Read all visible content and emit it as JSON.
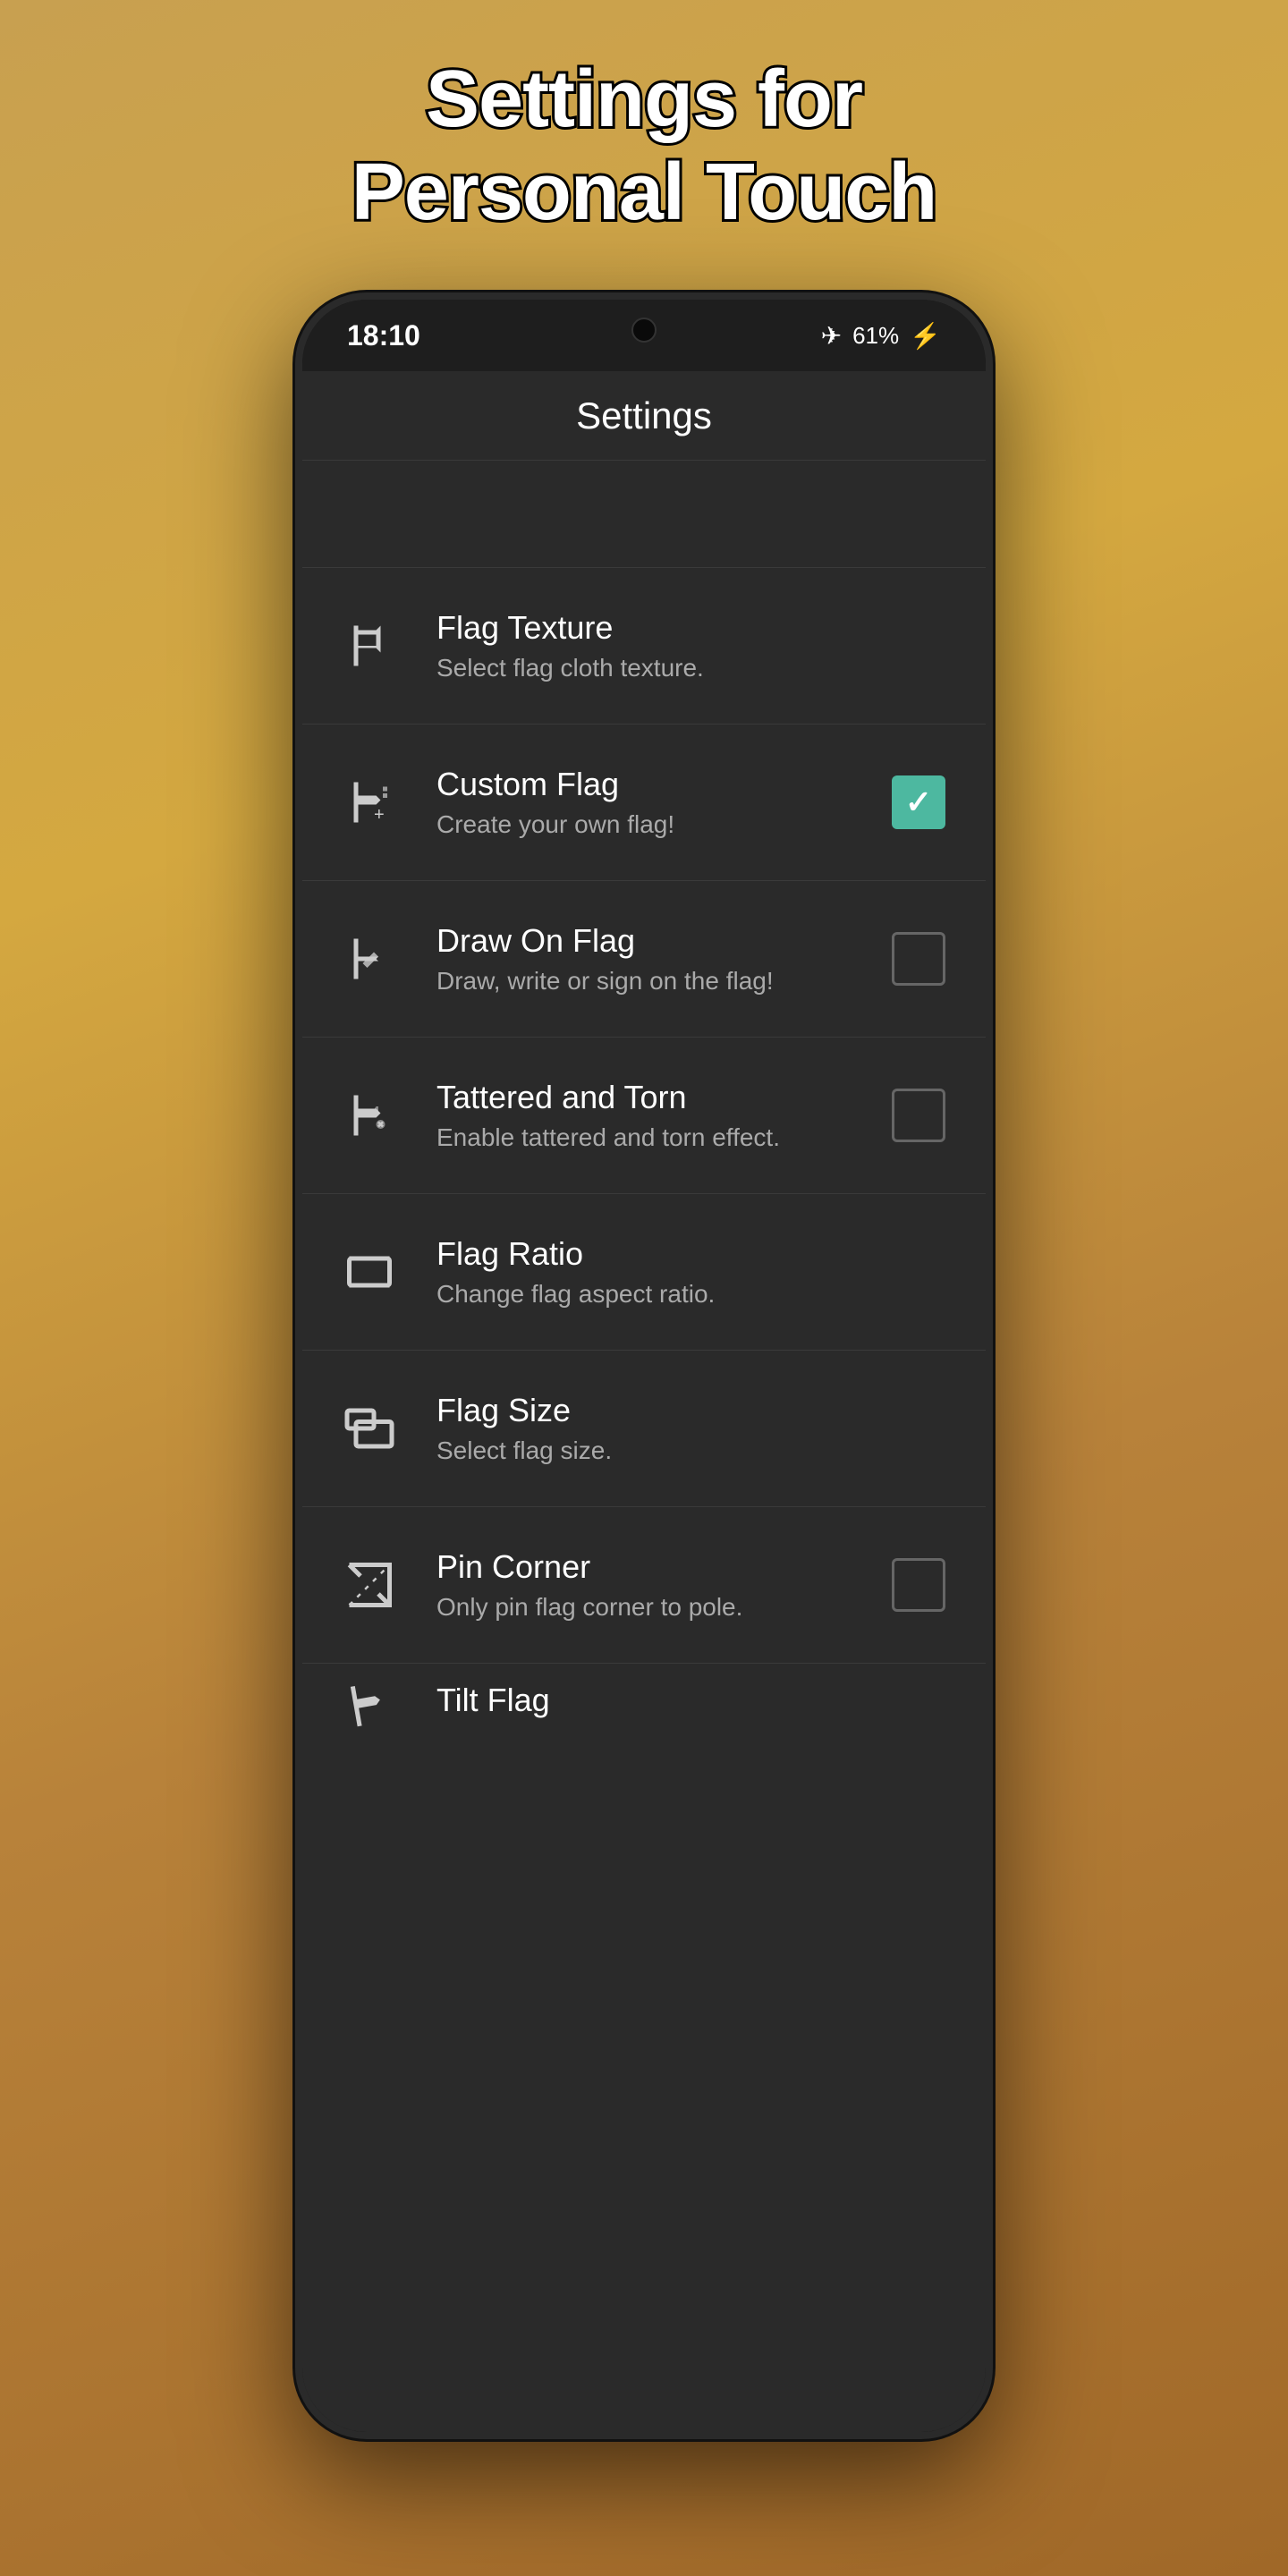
{
  "page": {
    "title_line1": "Settings for",
    "title_line2": "Personal Touch"
  },
  "status_bar": {
    "time": "18:10",
    "battery_percent": "61%",
    "airplane_icon": "✈",
    "battery_icon": "⚡"
  },
  "app_header": {
    "title": "Settings"
  },
  "settings_items": [
    {
      "id": "flag-texture",
      "title": "Flag Texture",
      "subtitle": "Select flag cloth texture.",
      "has_checkbox": false,
      "checked": false
    },
    {
      "id": "custom-flag",
      "title": "Custom Flag",
      "subtitle": "Create your own flag!",
      "has_checkbox": true,
      "checked": true
    },
    {
      "id": "draw-on-flag",
      "title": "Draw On Flag",
      "subtitle": "Draw, write or sign on the flag!",
      "has_checkbox": true,
      "checked": false
    },
    {
      "id": "tattered-torn",
      "title": "Tattered and Torn",
      "subtitle": "Enable tattered and torn effect.",
      "has_checkbox": true,
      "checked": false
    },
    {
      "id": "flag-ratio",
      "title": "Flag Ratio",
      "subtitle": "Change flag aspect ratio.",
      "has_checkbox": false,
      "checked": false
    },
    {
      "id": "flag-size",
      "title": "Flag Size",
      "subtitle": "Select flag size.",
      "has_checkbox": false,
      "checked": false
    },
    {
      "id": "pin-corner",
      "title": "Pin Corner",
      "subtitle": "Only pin flag corner to pole.",
      "has_checkbox": true,
      "checked": false
    },
    {
      "id": "tilt-flag",
      "title": "Tilt Flag",
      "subtitle": "",
      "has_checkbox": false,
      "checked": false
    }
  ]
}
